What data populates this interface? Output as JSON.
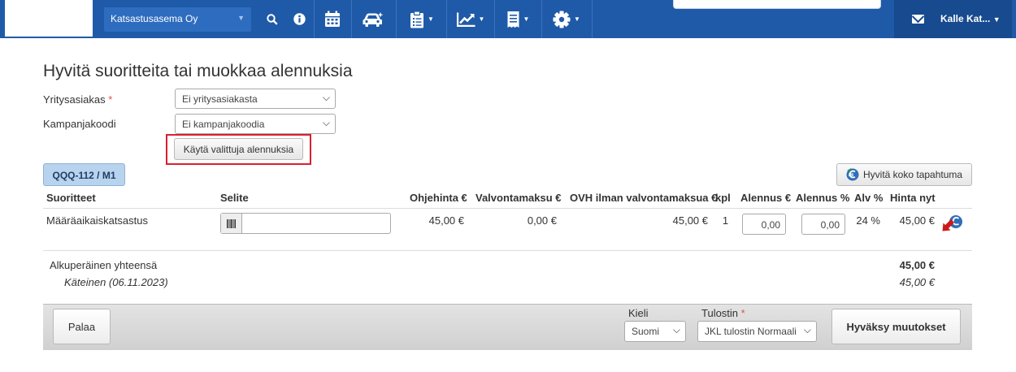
{
  "nav": {
    "company_select": "Katsastusasema Oy",
    "user_name": "Kalle Kat...",
    "icons": [
      "search-icon",
      "info-icon",
      "calendar-icon",
      "car-icon",
      "clipboard-icon",
      "chart-icon",
      "receipt-icon",
      "gear-icon",
      "mail-icon"
    ],
    "accent": "#1f5aa8"
  },
  "page": {
    "title": "Hyvitä suoritteita tai muokkaa alennuksia"
  },
  "form": {
    "company_customer_label": "Yritysasiakas",
    "required_mark": "*",
    "company_customer_value": "Ei yritysasiakasta",
    "campaign_code_label": "Kampanjakoodi",
    "campaign_code_value": "Ei kampanjakoodia",
    "apply_discounts_label": "Käytä valittuja alennuksia"
  },
  "vehicle_tab": "QQQ-112 / M1",
  "credit_whole_event_label": "Hyvitä koko tapahtuma",
  "table": {
    "headers": {
      "service": "Suoritteet",
      "description": "Selite",
      "list_price": "Ohjehinta €",
      "supervision_fee": "Valvontamaksu €",
      "vat_free": "OVH ilman valvontamaksua €",
      "qty": "kpl",
      "discount_eur": "Alennus €",
      "discount_pct": "Alennus %",
      "vat": "Alv %",
      "price_now": "Hinta nyt"
    },
    "rows": [
      {
        "service": "Määräaikaiskatsastus",
        "description": "",
        "list_price": "45,00 €",
        "supervision_fee": "0,00 €",
        "vat_free": "45,00 €",
        "qty": "1",
        "discount_eur": "0,00",
        "discount_pct": "0,00",
        "vat": "24 %",
        "price_now": "45,00 €"
      }
    ]
  },
  "totals": {
    "original_total_label": "Alkuperäinen yhteensä",
    "original_total_value": "45,00 €",
    "payment_label": "Käteinen (06.11.2023)",
    "payment_value": "45,00 €"
  },
  "footer": {
    "back_label": "Palaa",
    "language_label": "Kieli",
    "language_value": "Suomi",
    "printer_label": "Tulostin",
    "printer_value": "JKL tulostin Normaali",
    "accept_label": "Hyväksy muutokset"
  }
}
